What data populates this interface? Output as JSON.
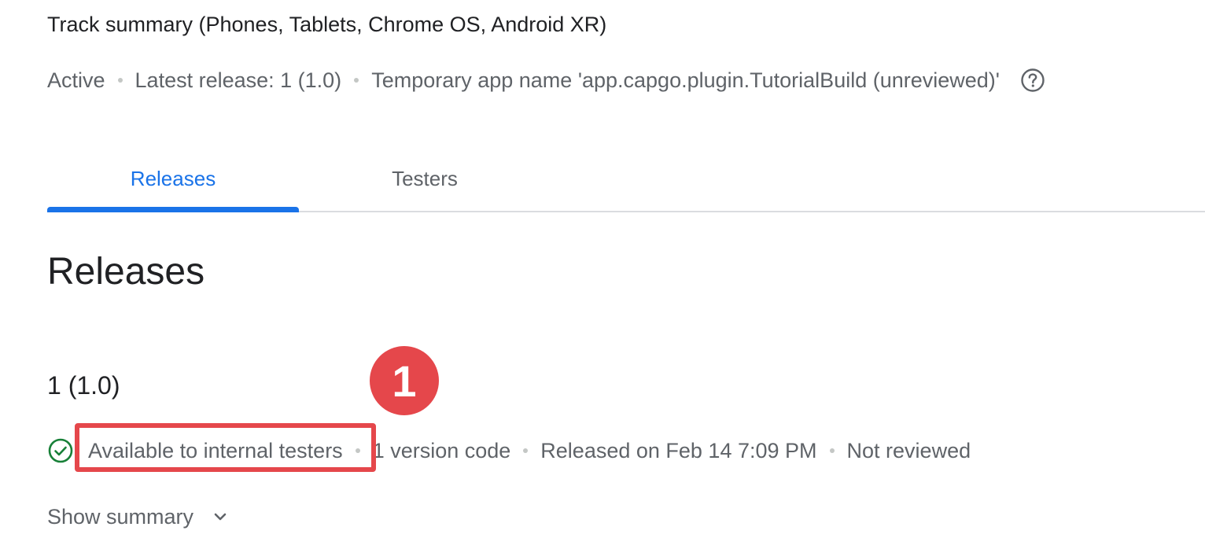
{
  "track": {
    "title": "Track summary (Phones, Tablets, Chrome OS, Android XR)",
    "status": "Active",
    "latest_release": "Latest release: 1 (1.0)",
    "temp_name": "Temporary app name 'app.capgo.plugin.TutorialBuild (unreviewed)'",
    "help_icon": "help-circle-icon"
  },
  "tabs": [
    {
      "label": "Releases",
      "active": true
    },
    {
      "label": "Testers",
      "active": false
    }
  ],
  "section": {
    "title": "Releases"
  },
  "release": {
    "name": "1 (1.0)",
    "status_icon": "check-circle-icon",
    "status": "Available to internal testers",
    "version_codes": "1 version code",
    "released_on": "Released on Feb 14 7:09 PM",
    "review": "Not reviewed",
    "show_summary": "Show summary",
    "chevron_icon": "chevron-down-icon"
  },
  "annotation": {
    "marker": "1"
  },
  "colors": {
    "accent": "#1a73e8",
    "annotation": "#e5474b",
    "success": "#188038",
    "text_primary": "#202124",
    "text_secondary": "#5f6368"
  }
}
